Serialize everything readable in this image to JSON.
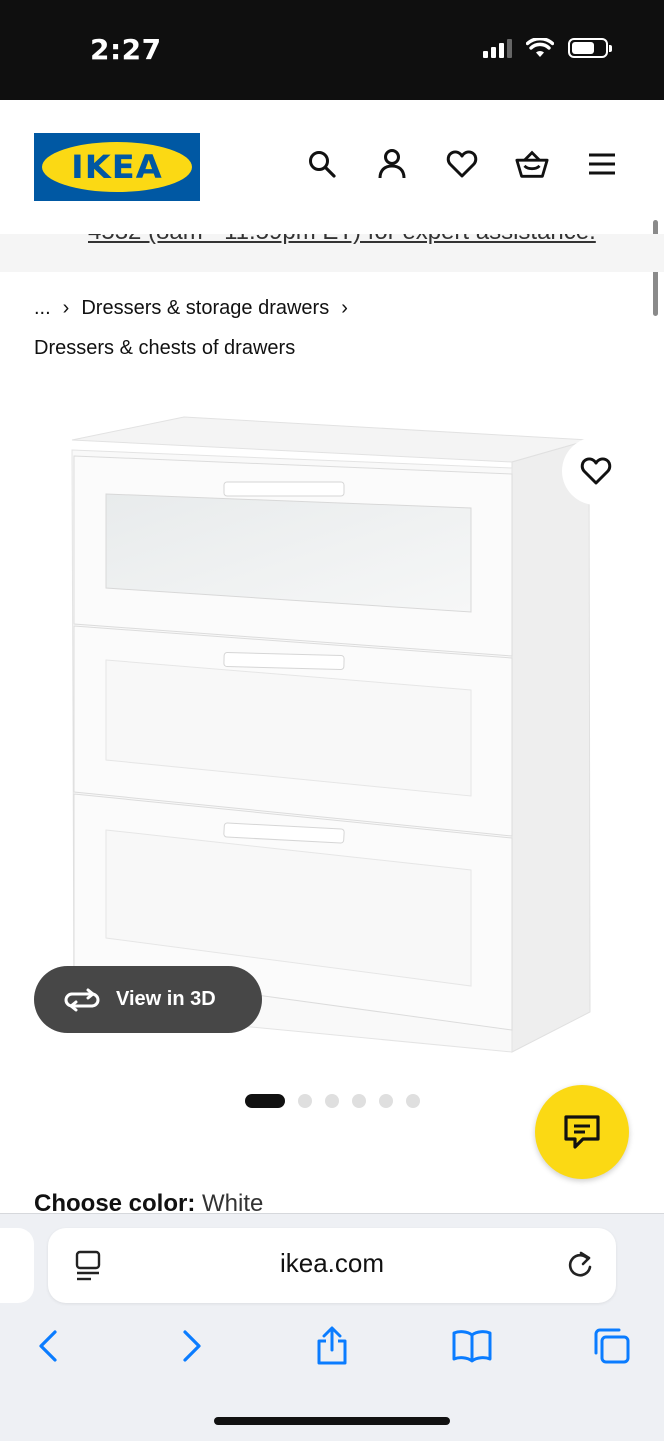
{
  "status_bar": {
    "time": "2:27"
  },
  "header": {
    "logo_text": "IKEA",
    "icons": [
      "search-icon",
      "profile-icon",
      "heart-icon",
      "basket-icon",
      "menu-icon"
    ]
  },
  "banner": {
    "text": "4532 (8am - 11:59pm ET) for expert assistance."
  },
  "breadcrumb": {
    "ellipsis": "...",
    "level1": "Dressers & storage drawers",
    "level2": "Dressers & chests of drawers"
  },
  "product": {
    "view_3d_label": "View in 3D",
    "image_count": 6,
    "active_image": 1
  },
  "color": {
    "label": "Choose color:",
    "value": "White"
  },
  "browser": {
    "domain": "ikea.com"
  },
  "colors": {
    "ikea_blue": "#0058a3",
    "ikea_yellow": "#fbd914",
    "safari_blue": "#0a7cff"
  }
}
